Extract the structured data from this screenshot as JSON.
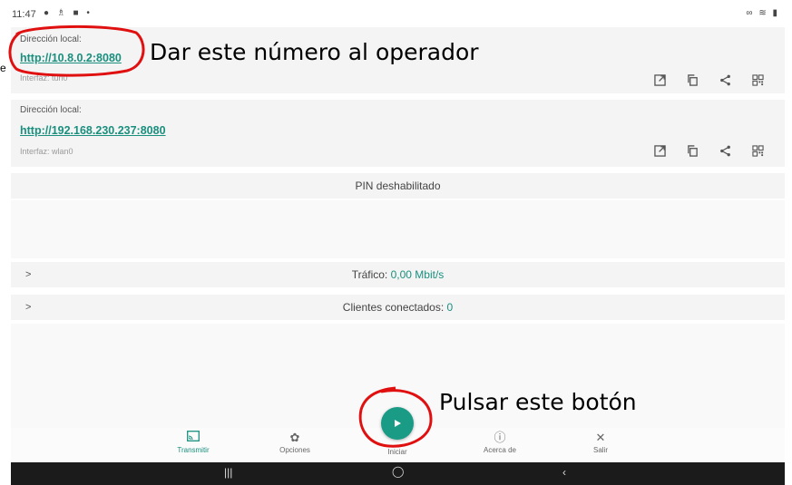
{
  "status_bar": {
    "time": "11:47",
    "left_icons": "● ♗ ■ •",
    "right_icons": "∞ ≋ ▮"
  },
  "addresses": [
    {
      "label": "Dirección local:",
      "url": "http://10.8.0.2:8080",
      "interface": "Interfaz: tun0"
    },
    {
      "label": "Dirección local:",
      "url": "http://192.168.230.237:8080",
      "interface": "Interfaz: wlan0"
    }
  ],
  "address_actions": [
    "open-external-icon",
    "copy-icon",
    "share-icon",
    "qr-code-icon"
  ],
  "pin_status": "PIN deshabilitado",
  "traffic": {
    "label": "Tráfico:",
    "value": "0,00 Mbit/s"
  },
  "clients": {
    "label": "Clientes conectados:",
    "value": "0"
  },
  "bottom_nav": {
    "items": [
      {
        "label": "Transmitir",
        "icon": "cast-icon"
      },
      {
        "label": "Opciones",
        "icon": "gear-icon"
      },
      {
        "label": "Iniciar",
        "icon": "play-icon"
      },
      {
        "label": "Acerca de",
        "icon": "info-icon"
      },
      {
        "label": "Salir",
        "icon": "close-icon"
      }
    ]
  },
  "annotations": {
    "address_note": "Dar este número al operador",
    "button_note": "Pulsar este botón",
    "stray_char": "e"
  },
  "colors": {
    "accent": "#1a8f7e",
    "annotation_circle": "#e01010",
    "system_bar": "#1b1b1b"
  }
}
